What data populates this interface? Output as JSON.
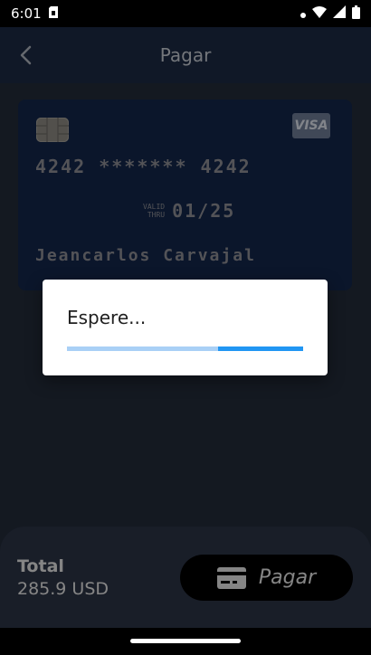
{
  "status_bar": {
    "time": "6:01"
  },
  "app_bar": {
    "title": "Pagar"
  },
  "card": {
    "brand": "VISA",
    "number": "4242 ******* 4242",
    "valid_label": "VALID\nTHRU",
    "expiry": "01/25",
    "holder": "Jeancarlos Carvajal"
  },
  "bottom": {
    "total_label": "Total",
    "total_value": "285.9 USD",
    "pay_label": "Pagar"
  },
  "dialog": {
    "message": "Espere...",
    "progress": 0.36
  },
  "colors": {
    "accent": "#2196f3",
    "card_background": "#13264a",
    "app_bar": "#1c2a44"
  }
}
